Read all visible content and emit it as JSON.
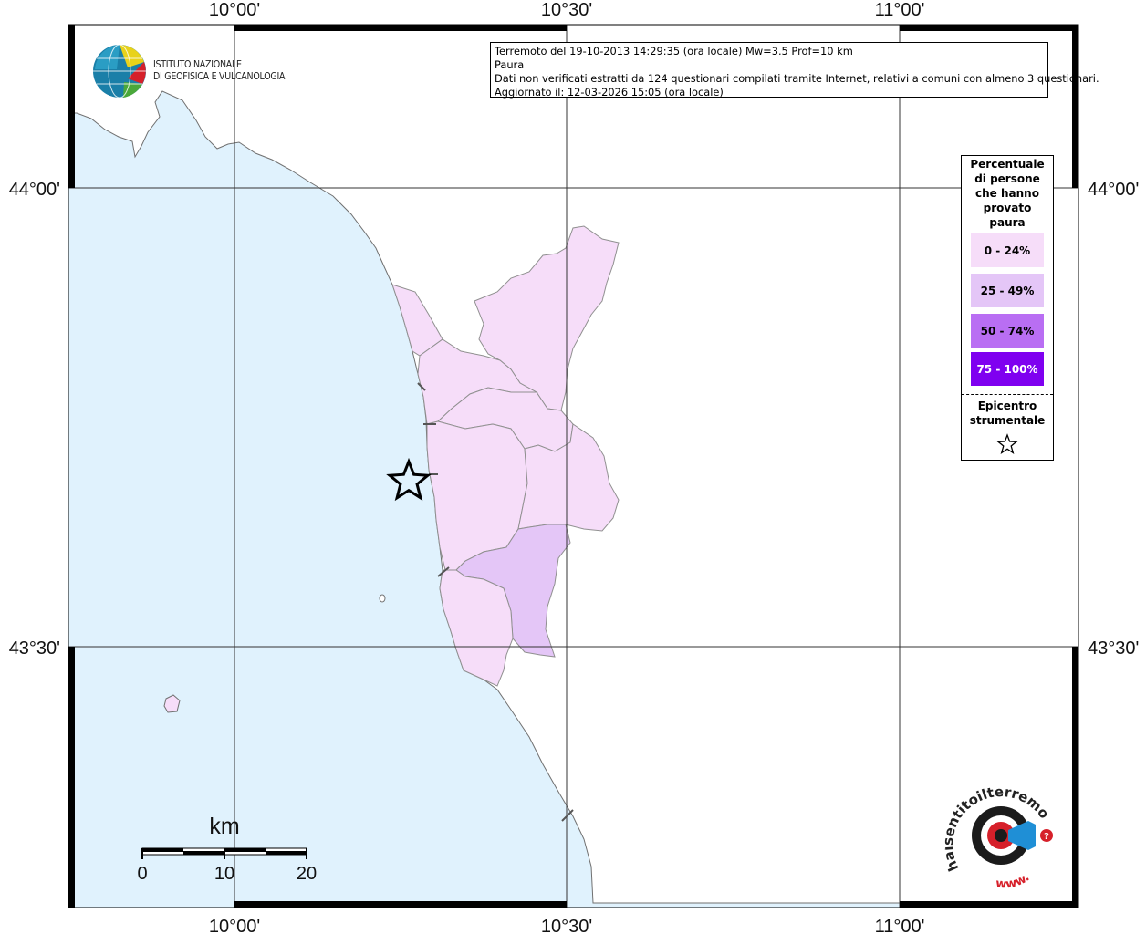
{
  "map": {
    "longitude_labels": [
      "10°00'",
      "10°30'",
      "11°00'"
    ],
    "latitude_labels": [
      "44°00'",
      "43°30'"
    ]
  },
  "info": {
    "line1": "Terremoto del 19-10-2013 14:29:35 (ora locale) Mw=3.5 Prof=10 km",
    "line2": "Paura",
    "line3": "Dati non verificati estratti da 124 questionari compilati tramite Internet, relativi a comuni con almeno 3 questionari.",
    "line4": "Aggiornato il: 12-03-2026 15:05 (ora locale)"
  },
  "legend": {
    "title": "Percentuale di persone che hanno provato paura",
    "classes": [
      {
        "label": "0 - 24%",
        "color": "#f6ddf9"
      },
      {
        "label": "25 - 49%",
        "color": "#e4c6f7"
      },
      {
        "label": "50 - 74%",
        "color": "#b96ef3"
      },
      {
        "label": "75 - 100%",
        "color": "#7f00f0"
      }
    ],
    "epicenter_label": "Epicentro strumentale"
  },
  "scalebar": {
    "unit": "km",
    "ticks": [
      "0",
      "10",
      "20"
    ]
  },
  "logos": {
    "ingv_line1": "ISTITUTO NAZIONALE",
    "ingv_line2": "DI GEOFISICA E VULCANOLOGIA",
    "hsit_text": "haisentitoilterremoto.it",
    "hsit_url": "www."
  },
  "colors": {
    "sea": "#e0f2fd",
    "land": "#ffffff",
    "municipality_0_24": "#f6ddf9",
    "municipality_25_49": "#e4c6f7",
    "border": "#909090"
  }
}
